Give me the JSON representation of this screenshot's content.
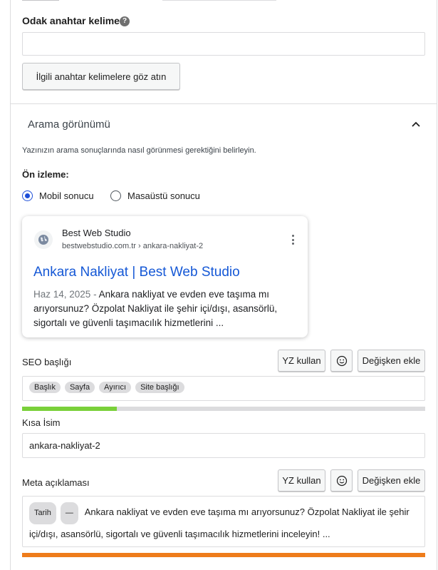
{
  "focus_keyword": {
    "label": "Odak anahtar kelime",
    "help_icon": "?",
    "value": "",
    "related_button": "İlgili anahtar kelimelere göz atın"
  },
  "search_appearance": {
    "title": "Arama görünümü",
    "description": "Yazınızın arama sonuçlarında nasıl görünmesi gerektiğini belirleyin.",
    "preview_label": "Ön izleme:",
    "options": [
      "Mobil sonucu",
      "Masaüstü sonucu"
    ],
    "selected": "Mobil sonucu"
  },
  "preview_card": {
    "site_name": "Best Web Studio",
    "url_domain": "bestwebstudio.com.tr",
    "url_path": "› ankara-nakliyat-2",
    "title": "Ankara Nakliyat | Best Web Studio",
    "date": "Haz 14, 2025",
    "date_sep": " - ",
    "description": "Ankara nakliyat ve evden eve taşıma mı arıyorsunuz? Özpolat Nakliyat ile şehir içi/dışı, asansörlü, sigortalı ve güvenli taşımacılık hizmetlerini ..."
  },
  "seo_title": {
    "label": "SEO başlığı",
    "ai_button": "YZ kullan",
    "emoji_icon": "smiley-icon",
    "variable_button": "Değişken ekle",
    "chips": [
      "Başlık",
      "Sayfa",
      "Ayırıcı",
      "Site başlığı"
    ],
    "progress": 0.235,
    "progress_color": "#7ad03a"
  },
  "slug": {
    "label": "Kısa İsim",
    "value": "ankara-nakliyat-2"
  },
  "meta_description": {
    "label": "Meta açıklaması",
    "ai_button": "YZ kullan",
    "variable_button": "Değişken ekle",
    "chips": [
      "Tarih",
      "—"
    ],
    "text": "Ankara nakliyat ve evden eve taşıma mı arıyorsunuz? Özpolat Nakliyat ile şehir içi/dışı, asansörlü, sigortalı ve güvenli taşımacılık hizmetlerini inceleyin! ...",
    "progress": 1.0,
    "progress_color": "#ee7c1b"
  },
  "colors": {
    "accent": "#1d4ed8",
    "serp_title": "#1558d6"
  }
}
